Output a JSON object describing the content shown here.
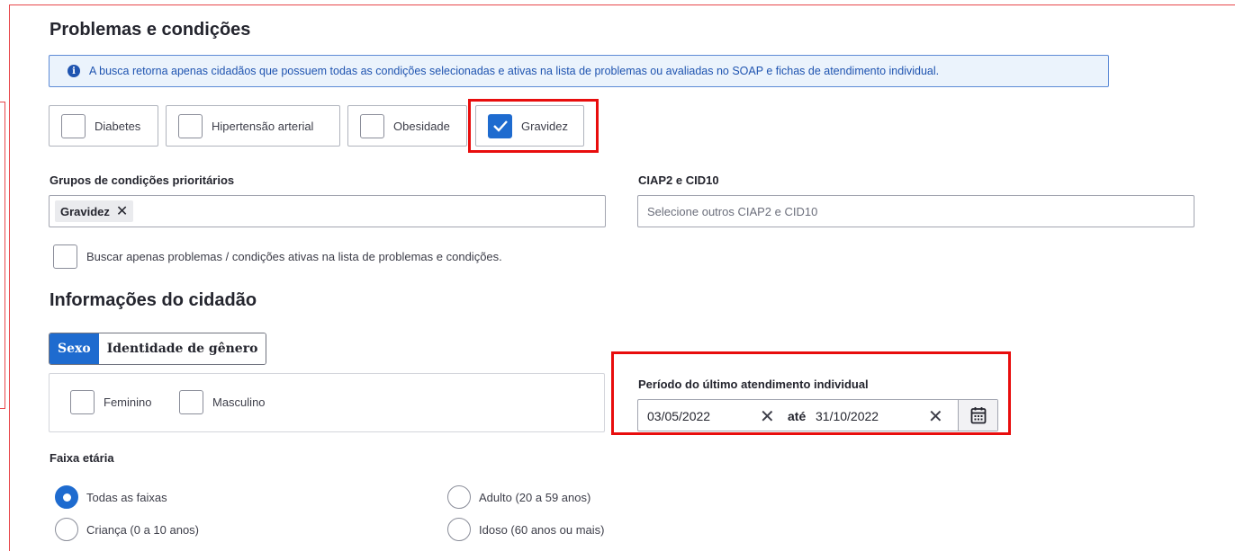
{
  "problemas": {
    "title": "Problemas e condições",
    "info": "A busca retorna apenas cidadãos que possuem todas as condições selecionadas e ativas na lista de problemas ou avaliadas no SOAP e fichas de atendimento individual.",
    "conditions": [
      {
        "label": "Diabetes",
        "checked": false
      },
      {
        "label": "Hipertensão arterial",
        "checked": false
      },
      {
        "label": "Obesidade",
        "checked": false
      },
      {
        "label": "Gravidez",
        "checked": true
      }
    ],
    "grupos_label": "Grupos de condições prioritários",
    "grupos_chip": "Gravidez",
    "ciap_label": "CIAP2 e CID10",
    "ciap_placeholder": "Selecione outros CIAP2 e CID10",
    "ativos_label": "Buscar apenas problemas / condições ativas na lista de problemas e condições."
  },
  "cidadao": {
    "title": "Informações do cidadão",
    "tabs": [
      {
        "label": "Sexo",
        "active": true
      },
      {
        "label": "Identidade de gênero",
        "active": false
      }
    ],
    "sexo_options": [
      "Feminino",
      "Masculino"
    ],
    "periodo_label": "Período do último atendimento individual",
    "date_from": "03/05/2022",
    "date_sep": "até",
    "date_to": "31/10/2022",
    "faixa_label": "Faixa etária",
    "faixas": [
      {
        "label": "Todas as faixas",
        "selected": true
      },
      {
        "label": "Adulto (20 a 59 anos)",
        "selected": false
      },
      {
        "label": "Criança (0 a 10 anos)",
        "selected": false
      },
      {
        "label": "Idoso (60 anos ou mais)",
        "selected": false
      }
    ]
  },
  "colors": {
    "primary": "#1e6bcf",
    "highlight": "#e80d0d",
    "info_bg": "#ebf3fc"
  }
}
